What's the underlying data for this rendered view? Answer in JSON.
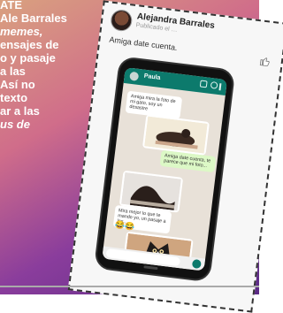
{
  "article": {
    "lines": [
      {
        "text": "ATE",
        "italic": false
      },
      {
        "text": "Ale Barrales",
        "italic": false
      },
      {
        "text": "memes,",
        "italic": true
      },
      {
        "text": "ensajes de",
        "italic": false
      },
      {
        "text": "o y pasaje",
        "italic": false
      },
      {
        "text": "a las",
        "italic": false
      },
      {
        "text": "Así no",
        "italic": false
      },
      {
        "text": "texto",
        "italic": false
      },
      {
        "text": "ar a las",
        "italic": false
      },
      {
        "text": "us de",
        "italic": true
      }
    ]
  },
  "post": {
    "author": "Alejandra Barrales",
    "meta": "Publicado el …",
    "text": "Amiga date cuenta."
  },
  "chat": {
    "contact": "Paula",
    "messages": [
      {
        "text": "Amiga mira la foto de mi gato, soy un desastre",
        "out": false
      },
      {
        "text": "Amiga date cuenta, te parece que mi foto...",
        "out": true
      },
      {
        "text": "Mira mejor lo que te mando yo, un pasaje a las...",
        "out": false
      }
    ]
  },
  "colors": {
    "gradient": [
      "#d9a17f",
      "#d06d8a",
      "#8a3d9c",
      "#5b2b86"
    ],
    "whatsapp_green": "#0c7a6c"
  },
  "icons": {
    "like": "thumbs-up-icon",
    "send": "send-icon"
  }
}
